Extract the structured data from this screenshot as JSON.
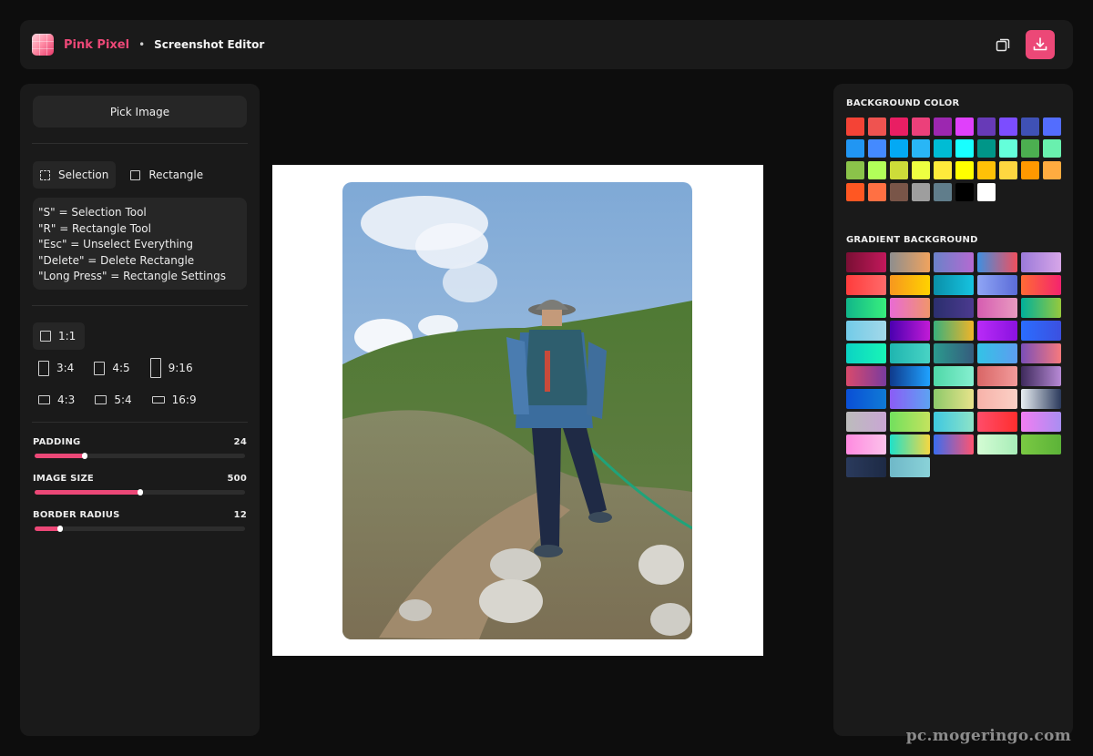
{
  "header": {
    "brand": "Pink Pixel",
    "separator": "•",
    "subtitle": "Screenshot Editor",
    "copy_icon": "copy-icon",
    "download_icon": "download-icon",
    "accent_color": "#ec4877"
  },
  "left_panel": {
    "pick_image_label": "Pick Image",
    "tools": [
      {
        "label": "Selection",
        "icon": "selection-icon",
        "active": true
      },
      {
        "label": "Rectangle",
        "icon": "rectangle-icon",
        "active": false
      }
    ],
    "shortcuts": [
      "\"S\" = Selection Tool",
      "\"R\" = Rectangle Tool",
      "\"Esc\" = Unselect Everything",
      "\"Delete\" = Delete Rectangle",
      "\"Long Press\" = Rectangle Settings"
    ],
    "ratios": {
      "r1_1": "1:1",
      "r3_4": "3:4",
      "r4_5": "4:5",
      "r9_16": "9:16",
      "r4_3": "4:3",
      "r5_4": "5:4",
      "r16_9": "16:9",
      "selected": "1:1"
    },
    "sliders": {
      "padding": {
        "label": "PADDING",
        "value": "24",
        "fraction": 0.24
      },
      "image_size": {
        "label": "IMAGE SIZE",
        "value": "500",
        "fraction": 0.5
      },
      "border_radius": {
        "label": "BORDER RADIUS",
        "value": "12",
        "fraction": 0.12
      }
    }
  },
  "canvas": {
    "background": "#ffffff",
    "image_description": "hiker-photo"
  },
  "right_panel": {
    "background_title": "BACKGROUND COLOR",
    "colors": [
      "#f44336",
      "#ef5350",
      "#e91e63",
      "#ec407a",
      "#9c27b0",
      "#e040fb",
      "#673ab7",
      "#7c4dff",
      "#3f51b5",
      "#536dfe",
      "#2196f3",
      "#448aff",
      "#03a9f4",
      "#29b6f6",
      "#00bcd4",
      "#18ffff",
      "#009688",
      "#64ffda",
      "#4caf50",
      "#69f0ae",
      "#8bc34a",
      "#b2ff59",
      "#cddc39",
      "#eeff41",
      "#ffeb3b",
      "#ffff00",
      "#ffc107",
      "#ffd740",
      "#ff9800",
      "#ffab40",
      "#ff5722",
      "#ff7043",
      "#795548",
      "#9e9e9e",
      "#607d8b",
      "#000000",
      "#ffffff"
    ],
    "gradient_title": "GRADIENT BACKGROUND",
    "gradients": [
      [
        "#7a0f34",
        "#c2185b"
      ],
      [
        "#8e8e8e",
        "#f0a35e"
      ],
      [
        "#6a82c9",
        "#b56ad1"
      ],
      [
        "#3f8fe0",
        "#f0505e"
      ],
      [
        "#9b7ad9",
        "#d7a6e8"
      ],
      [
        "#ff3c3c",
        "#ff6a6a"
      ],
      [
        "#f7971e",
        "#ffd200"
      ],
      [
        "#0a8fa8",
        "#16c3e0"
      ],
      [
        "#8fa5f5",
        "#5b6cd8"
      ],
      [
        "#ff6b35",
        "#f4246e"
      ],
      [
        "#11b68a",
        "#38ef7d"
      ],
      [
        "#e96bd4",
        "#f0956b"
      ],
      [
        "#2b2f6e",
        "#4b3a8f"
      ],
      [
        "#d65db1",
        "#e89ac0"
      ],
      [
        "#00b09b",
        "#96c93d"
      ],
      [
        "#72cbe8",
        "#a3d8e9"
      ],
      [
        "#4a00b0",
        "#c21bd6"
      ],
      [
        "#3ab07b",
        "#f0b429"
      ],
      [
        "#b92bf7",
        "#8a12e0"
      ],
      [
        "#2a6dff",
        "#3c50e0"
      ],
      [
        "#0bd3c4",
        "#19f5b6"
      ],
      [
        "#1fb5b0",
        "#48d3c4"
      ],
      [
        "#2b9a8e",
        "#355c7d"
      ],
      [
        "#33c3e6",
        "#5d9df0"
      ],
      [
        "#7a4fb8",
        "#f7797d"
      ],
      [
        "#d94a6c",
        "#7a3b9e"
      ],
      [
        "#0f3a8c",
        "#1fa2ff"
      ],
      [
        "#4fd8a8",
        "#86efd0"
      ],
      [
        "#d96666",
        "#f29b9b"
      ],
      [
        "#3e2a5c",
        "#b88ad6"
      ],
      [
        "#0a4fd6",
        "#0f7ad6"
      ],
      [
        "#8b5cf6",
        "#5da3f2"
      ],
      [
        "#8dc96a",
        "#e8e38a"
      ],
      [
        "#f7b2a9",
        "#fbd0c6"
      ],
      [
        "#e8eef2",
        "#2b3a5c"
      ],
      [
        "#bcbcbc",
        "#c9a6d4"
      ],
      [
        "#72e05e",
        "#c4e35e"
      ],
      [
        "#3ec8e0",
        "#8ee3c8"
      ],
      [
        "#ff4d6a",
        "#ff2e2e"
      ],
      [
        "#f27ef2",
        "#a98ef2"
      ],
      [
        "#ff8ae0",
        "#fbc2eb"
      ],
      [
        "#1fe0c9",
        "#f5d742"
      ],
      [
        "#3a6df0",
        "#ff5470"
      ],
      [
        "#d4fcd4",
        "#a8edb8"
      ],
      [
        "#7ac943",
        "#5cb338"
      ],
      [
        "#2a3a5c",
        "#1d2a45"
      ],
      [
        "#6fb8c8",
        "#8ad2d8"
      ]
    ]
  },
  "watermark": "pc.mogeringo.com"
}
